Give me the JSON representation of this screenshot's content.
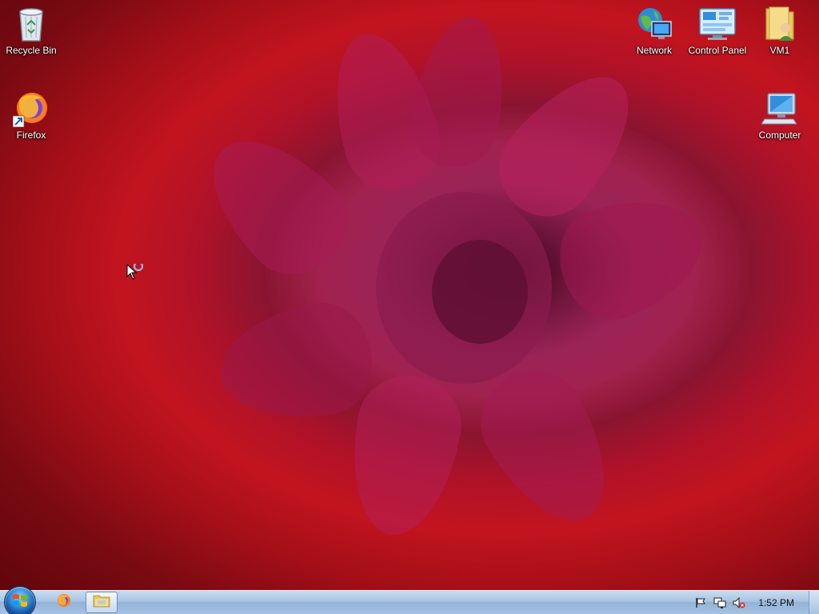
{
  "desktop": {
    "icons_left": [
      {
        "label": "Recycle Bin",
        "icon": "recycle-bin-icon"
      },
      {
        "label": "Firefox",
        "icon": "firefox-icon"
      }
    ],
    "icons_right": [
      {
        "label": "Network",
        "icon": "network-icon"
      },
      {
        "label": "Control Panel",
        "icon": "control-panel-icon"
      },
      {
        "label": "VM1",
        "icon": "user-folder-icon"
      },
      {
        "label": "Computer",
        "icon": "computer-icon"
      }
    ]
  },
  "taskbar": {
    "start": {
      "icon": "windows-logo-icon"
    },
    "pinned": [
      {
        "icon": "firefox-icon"
      },
      {
        "icon": "file-explorer-icon",
        "active": true
      }
    ],
    "tray": {
      "icons": [
        "action-center-flag-icon",
        "network-status-icon",
        "volume-muted-icon"
      ],
      "clock": "1:52 PM"
    }
  },
  "colors": {
    "wallpaper_primary": "#c2141f",
    "wallpaper_center": "#9b2357",
    "taskbar": "#a9c4e2"
  }
}
